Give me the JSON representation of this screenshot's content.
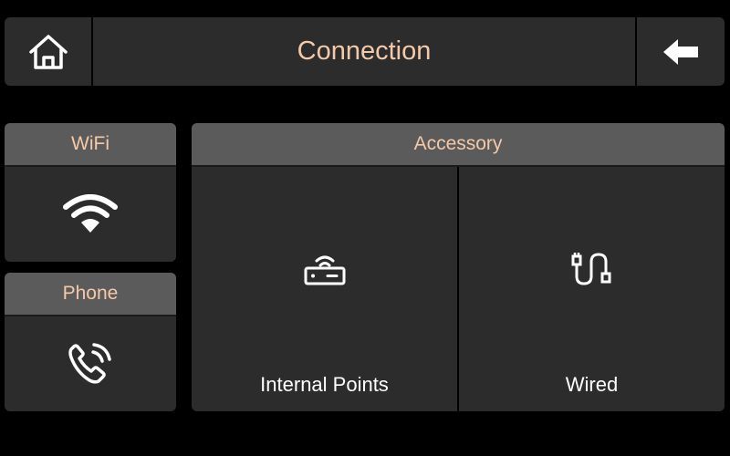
{
  "header": {
    "title": "Connection",
    "home_icon": "home-icon",
    "back_icon": "arrow-left-icon"
  },
  "wifi": {
    "label": "WiFi",
    "icon": "wifi-icon"
  },
  "phone": {
    "label": "Phone",
    "icon": "phone-ringing-icon"
  },
  "accessory": {
    "label": "Accessory",
    "items": [
      {
        "label": "Internal Points",
        "icon": "router-icon"
      },
      {
        "label": "Wired",
        "icon": "cable-icon"
      }
    ]
  },
  "colors": {
    "background": "#000000",
    "panel": "#2c2c2c",
    "panel_header": "#5b5b5b",
    "accent_text": "#f4c9a8",
    "text": "#ffffff"
  }
}
